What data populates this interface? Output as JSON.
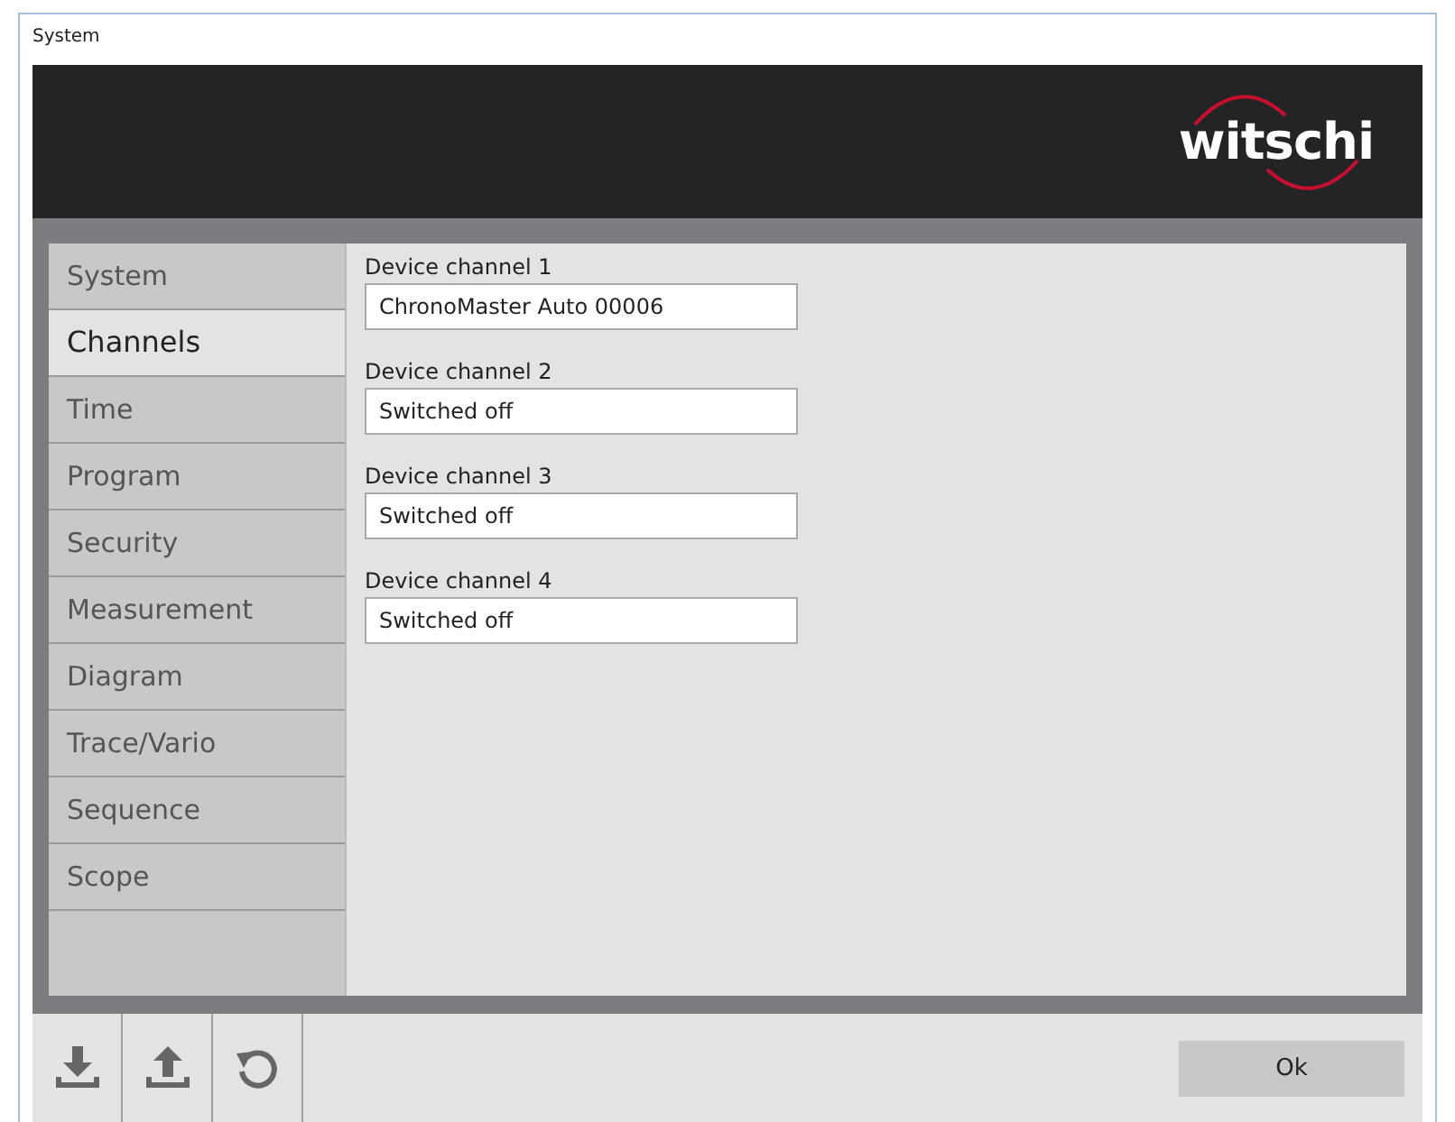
{
  "window": {
    "title": "System"
  },
  "logo": {
    "text": "witschi"
  },
  "sidebar": {
    "items": [
      {
        "label": "System",
        "selected": false
      },
      {
        "label": "Channels",
        "selected": true
      },
      {
        "label": "Time",
        "selected": false
      },
      {
        "label": "Program",
        "selected": false
      },
      {
        "label": "Security",
        "selected": false
      },
      {
        "label": "Measurement",
        "selected": false
      },
      {
        "label": "Diagram",
        "selected": false
      },
      {
        "label": "Trace/Vario",
        "selected": false
      },
      {
        "label": "Sequence",
        "selected": false
      },
      {
        "label": "Scope",
        "selected": false
      }
    ]
  },
  "fields": [
    {
      "label": "Device channel 1",
      "value": "ChronoMaster Auto 00006"
    },
    {
      "label": "Device channel 2",
      "value": "Switched off"
    },
    {
      "label": "Device channel 3",
      "value": "Switched off"
    },
    {
      "label": "Device channel 4",
      "value": "Switched off"
    }
  ],
  "toolbar": [
    {
      "kind": "download"
    },
    {
      "kind": "upload"
    },
    {
      "kind": "reset"
    }
  ],
  "buttons": [
    "Ok"
  ]
}
